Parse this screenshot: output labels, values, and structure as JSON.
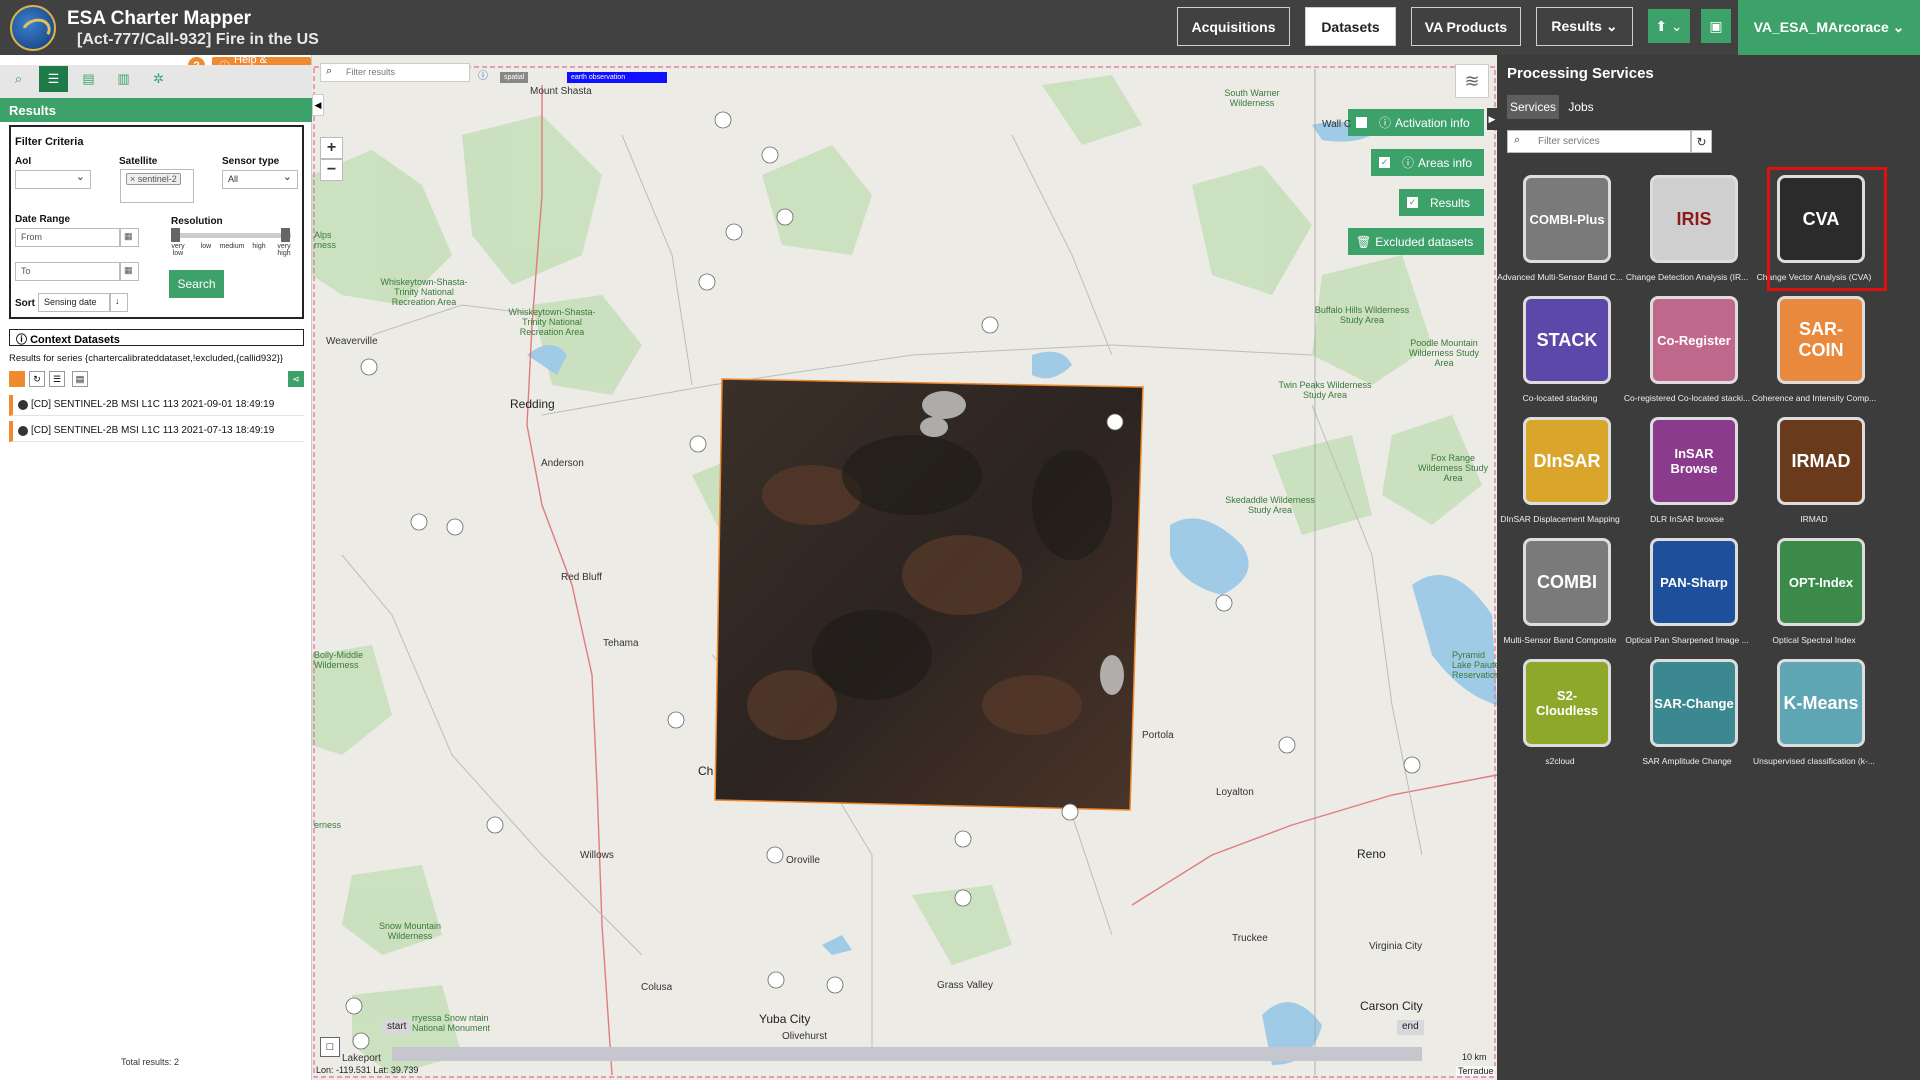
{
  "header": {
    "app_title": "ESA Charter Mapper",
    "subtitle": "[Act-777/Call-932] Fire in the US",
    "nav": [
      "Acquisitions",
      "Datasets",
      "VA Products",
      "Results ⌄"
    ],
    "user": "VA_ESA_MArcorace ⌄"
  },
  "left_panel": {
    "help_label": "Help & Manual",
    "results_title": "Results",
    "filter_title": "Filter Criteria",
    "aoi_label": "AoI",
    "satellite_label": "Satellite",
    "satellite_tag": "sentinel-2",
    "sensor_type_label": "Sensor type",
    "sensor_type_value": "All",
    "date_range_label": "Date Range",
    "from_placeholder": "From",
    "to_placeholder": "To",
    "resolution_label": "Resolution",
    "resolution_ticks": [
      "very low",
      "low",
      "medium",
      "high",
      "very high"
    ],
    "sort_label": "Sort",
    "sort_value": "Sensing date",
    "search_label": "Search",
    "context_title": "Context Datasets",
    "series_text": "Results for series {chartercalibrateddataset,!excluded,{callid932}}",
    "results": [
      "[CD] SENTINEL-2B MSI L1C 113 2021-09-01 18:49:19",
      "[CD] SENTINEL-2B MSI L1C 113 2021-07-13 18:49:19"
    ],
    "total": "Total results: 2"
  },
  "map": {
    "filter_placeholder": "Filter results",
    "tags": [
      "spatial",
      "earth observation"
    ],
    "pills": [
      "Activation info",
      "Areas info",
      "Results",
      "Excluded datasets"
    ],
    "places": {
      "mount_shasta": "Mount Shasta",
      "redding": "Redding",
      "anderson": "Anderson",
      "red_bluff": "Red Bluff",
      "tehama": "Tehama",
      "weaverville": "Weaverville",
      "willows": "Willows",
      "oroville": "Oroville",
      "chico": "Ch",
      "portola": "Portola",
      "loyalton": "Loyalton",
      "reno": "Reno",
      "truckee": "Truckee",
      "virginia_city": "Virginia City",
      "carson_city": "Carson City",
      "grass_valley": "Grass Valley",
      "yuba_city": "Yuba City",
      "colusa": "Colusa",
      "olivehurst": "Olivehurst",
      "lakeport": "Lakeport",
      "wall": "Wall C"
    },
    "green_places": {
      "whiskeytown1": "Whiskeytown-Shasta-Trinity National Recreation Area",
      "whiskeytown2": "Whiskeytown-Shasta-Trinity National Recreation Area",
      "buffalo": "Buffalo Hills Wilderness Study Area",
      "poodle": "Poodle Mountain Wilderness Study Area",
      "twin_peaks": "Twin Peaks Wilderness Study Area",
      "fox_range": "Fox Range Wilderness Study Area",
      "skedaddle": "Skedaddle Wilderness Study Area",
      "south_warner": "South Warner Wilderness",
      "snow_mountain": "Snow Mountain Wilderness",
      "bolly": "Bolly-Middle Wilderness",
      "cryassa": "rryessa Snow ntain National Monument",
      "pyramid": "Pyramid Lake Paiute Reservation",
      "alps": "Alps rness",
      "erness": "erness"
    },
    "timeline_start": "start",
    "timeline_end": "end",
    "coords": "Lon: -119.531  Lat: 39.739",
    "scale": "10 km",
    "attribution": "Terradue"
  },
  "right_panel": {
    "title": "Processing Services",
    "tabs": [
      "Services",
      "Jobs"
    ],
    "filter_placeholder": "Filter services",
    "services": [
      {
        "tile": "COMBI-Plus",
        "caption": "Advanced Multi-Sensor Band C...",
        "color": "#7a7a7a"
      },
      {
        "tile": "IRIS",
        "caption": "Change Detection Analysis (IR...",
        "color": "#cfcfcf"
      },
      {
        "tile": "CVA",
        "caption": "Change Vector Analysis (CVA)",
        "color": "#2b2b2b"
      },
      {
        "tile": "STACK",
        "caption": "Co-located stacking",
        "color": "#5b48a8"
      },
      {
        "tile": "Co-Register",
        "caption": "Co-registered Co-located stacki...",
        "color": "#c0688c"
      },
      {
        "tile": "SAR-COIN",
        "caption": "Coherence and Intensity Comp...",
        "color": "#e9893e"
      },
      {
        "tile": "DInSAR",
        "caption": "DInSAR Displacement Mapping",
        "color": "#d9a52b"
      },
      {
        "tile": "InSAR Browse",
        "caption": "DLR InSAR browse",
        "color": "#8a3b8c"
      },
      {
        "tile": "IRMAD",
        "caption": "IRMAD",
        "color": "#6a3a1c"
      },
      {
        "tile": "COMBI",
        "caption": "Multi-Sensor Band Composite",
        "color": "#7a7a7a"
      },
      {
        "tile": "PAN-Sharp",
        "caption": "Optical Pan Sharpened Image ...",
        "color": "#1d4f9a"
      },
      {
        "tile": "OPT-Index",
        "caption": "Optical Spectral Index",
        "color": "#3b8a4a"
      },
      {
        "tile": "S2-Cloudless",
        "caption": "s2cloud",
        "color": "#8ea82c"
      },
      {
        "tile": "SAR-Change",
        "caption": "SAR Amplitude Change",
        "color": "#3b8890"
      },
      {
        "tile": "K-Means",
        "caption": "Unsupervised classification (k-...",
        "color": "#5fa6b5"
      }
    ]
  }
}
